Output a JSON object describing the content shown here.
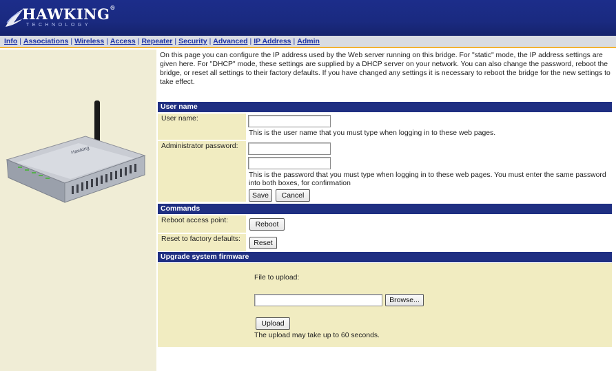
{
  "brand": {
    "name": "HAWKING",
    "registered": "®",
    "sub": "TECHNOLOGY"
  },
  "nav": [
    {
      "label": "Info"
    },
    {
      "label": "Associations"
    },
    {
      "label": "Wireless"
    },
    {
      "label": "Access"
    },
    {
      "label": "Repeater"
    },
    {
      "label": "Security"
    },
    {
      "label": "Advanced"
    },
    {
      "label": "IP Address"
    },
    {
      "label": "Admin"
    }
  ],
  "nav_separator": "|",
  "intro_text": "On this page you can configure the IP address used by the Web server running on this bridge. For \"static\" mode, the IP address settings are given here. For \"DHCP\" mode, these settings are supplied by a DHCP server on your network. You can also change the password, reboot the bridge, or reset all settings to their factory defaults. If you have changed any settings it is necessary to reboot the bridge for the new settings to take effect.",
  "sections": {
    "username": {
      "title": "User name",
      "user_label": "User name:",
      "user_value": "",
      "user_help": "This is the user name that you must type when logging in to these web pages.",
      "pass_label": "Administrator password:",
      "pass_value": "",
      "pass_confirm_value": "",
      "pass_help": "This is the password that you must type when logging in to these web pages. You must enter the same password into both boxes, for confirmation",
      "save_label": "Save",
      "cancel_label": "Cancel"
    },
    "commands": {
      "title": "Commands",
      "reboot_label": "Reboot access point:",
      "reboot_button": "Reboot",
      "reset_label": "Reset to factory defaults:",
      "reset_button": "Reset"
    },
    "firmware": {
      "title": "Upgrade system firmware",
      "file_label": "File to upload:",
      "file_value": "",
      "browse_button": "Browse...",
      "upload_button": "Upload",
      "upload_note": "The upload may take up to 60 seconds."
    }
  },
  "colors": {
    "header_bg": "#1c2d8a",
    "section_bar": "#1f2f82",
    "label_bg": "#f1ecc1",
    "nav_link": "#1f34a8",
    "nav_underline": "#f2b233"
  }
}
